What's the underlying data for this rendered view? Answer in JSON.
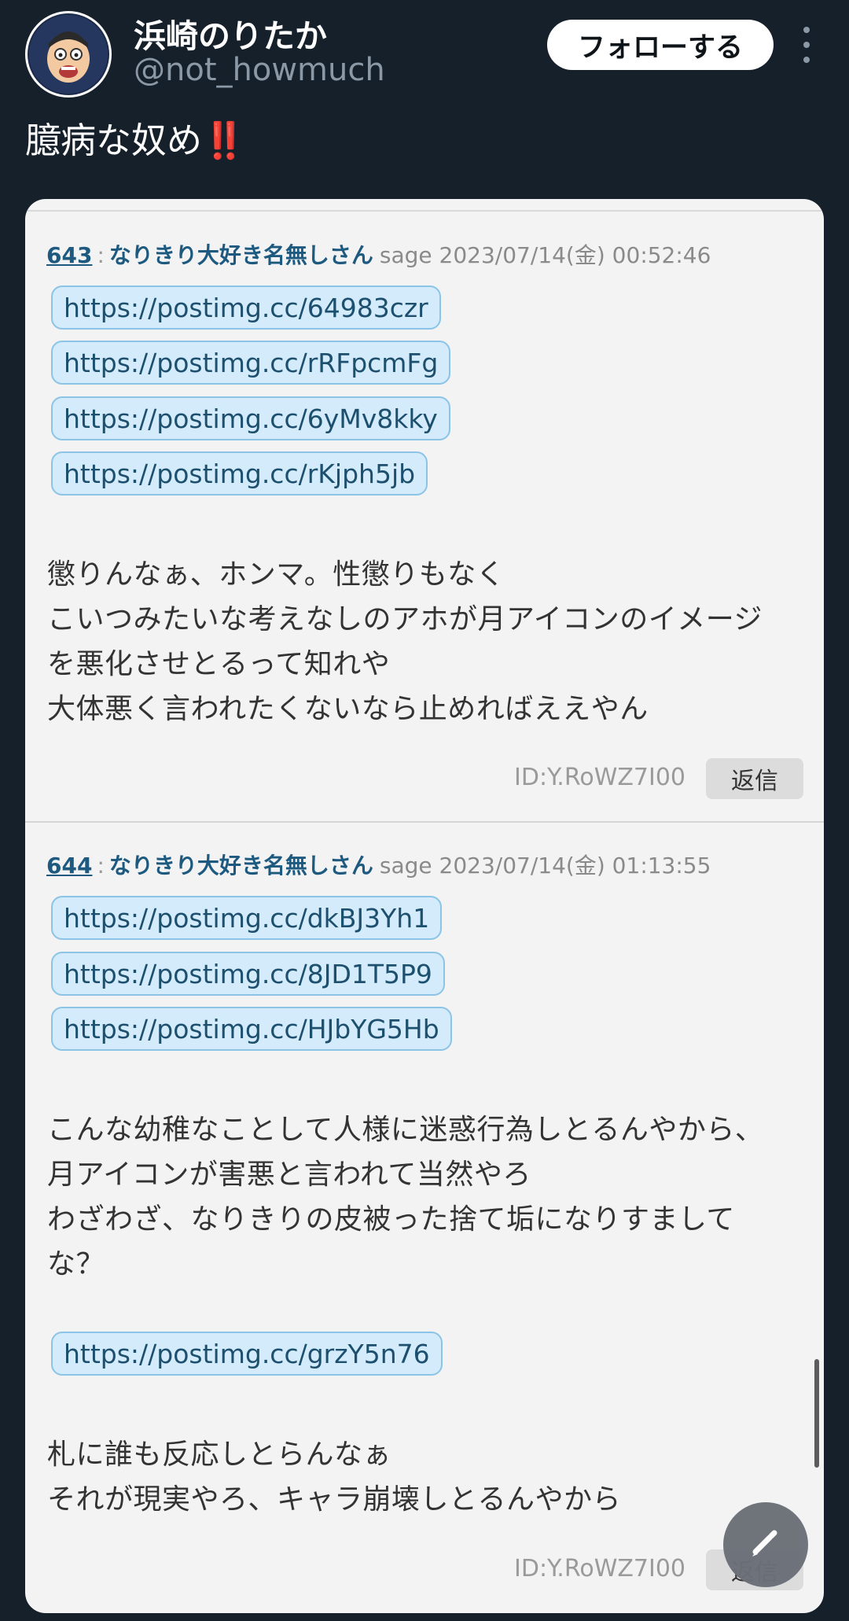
{
  "author": {
    "name": "浜崎のりたか",
    "handle": "@not_howmuch"
  },
  "follow_label": "フォローする",
  "tweet": {
    "text": "臆病な奴め",
    "emoji": "‼️"
  },
  "posts": [
    {
      "number": "643",
      "colon": ":",
      "name": "なりきり大好き名無しさん",
      "meta": "sage 2023/07/14(金) 00:52:46",
      "links": [
        "https://postimg.cc/64983czr",
        "https://postimg.cc/rRFpcmFg",
        "https://postimg.cc/6yMv8kky",
        "https://postimg.cc/rKjph5jb"
      ],
      "lines": [
        "懲りんなぁ、ホンマ。性懲りもなく",
        "こいつみたいな考えなしのアホが月アイコンのイメージ",
        "を悪化させとるって知れや",
        "大体悪く言われたくないなら止めればええやん"
      ],
      "id": "ID:Y.RoWZ7I00",
      "reply": "返信"
    },
    {
      "number": "644",
      "colon": ":",
      "name": "なりきり大好き名無しさん",
      "meta": "sage 2023/07/14(金) 01:13:55",
      "links": [
        "https://postimg.cc/dkBJ3Yh1",
        "https://postimg.cc/8JD1T5P9",
        "https://postimg.cc/HJbYG5Hb"
      ],
      "lines": [
        "こんな幼稚なことして人様に迷惑行為しとるんやから、",
        "月アイコンが害悪と言われて当然やろ",
        "わざわざ、なりきりの皮被った捨て垢になりすまして",
        "な？"
      ],
      "links2": [
        "https://postimg.cc/grzY5n76"
      ],
      "lines2": [
        "札に誰も反応しとらんなぁ",
        "それが現実やろ、キャラ崩壊しとるんやから"
      ],
      "id": "ID:Y.RoWZ7I00",
      "reply": "返信"
    }
  ],
  "icons": {
    "more": "more-vertical-icon",
    "compose": "compose-pencil-icon"
  }
}
